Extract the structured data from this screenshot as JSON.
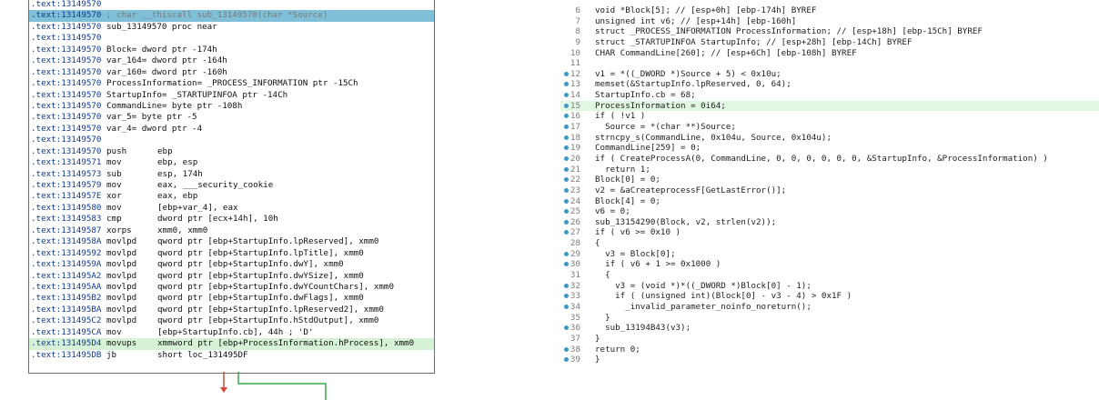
{
  "disasm": {
    "lines": [
      {
        "addr": ".text:13149570",
        "mn": "",
        "ops": "",
        "cmt": "",
        "hl": false
      },
      {
        "addr": ".text:13149570",
        "mn": "",
        "ops": "",
        "cmt": "; char __thiscall sub_13149570(char *Source)",
        "hl": true
      },
      {
        "addr": ".text:13149570",
        "mn": "sub_13149570 proc near",
        "ops": "",
        "cmt": "",
        "hl": false
      },
      {
        "addr": ".text:13149570",
        "mn": "",
        "ops": "",
        "cmt": "",
        "hl": false
      },
      {
        "addr": ".text:13149570",
        "mn": "Block= dword ptr -174h",
        "ops": "",
        "cmt": "",
        "hl": false
      },
      {
        "addr": ".text:13149570",
        "mn": "var_164= dword ptr -164h",
        "ops": "",
        "cmt": "",
        "hl": false
      },
      {
        "addr": ".text:13149570",
        "mn": "var_160= dword ptr -160h",
        "ops": "",
        "cmt": "",
        "hl": false
      },
      {
        "addr": ".text:13149570",
        "mn": "ProcessInformation= _PROCESS_INFORMATION ptr -15Ch",
        "ops": "",
        "cmt": "",
        "hl": false
      },
      {
        "addr": ".text:13149570",
        "mn": "StartupInfo= _STARTUPINFOA ptr -14Ch",
        "ops": "",
        "cmt": "",
        "hl": false
      },
      {
        "addr": ".text:13149570",
        "mn": "CommandLine= byte ptr -108h",
        "ops": "",
        "cmt": "",
        "hl": false
      },
      {
        "addr": ".text:13149570",
        "mn": "var_5= byte ptr -5",
        "ops": "",
        "cmt": "",
        "hl": false
      },
      {
        "addr": ".text:13149570",
        "mn": "var_4= dword ptr -4",
        "ops": "",
        "cmt": "",
        "hl": false
      },
      {
        "addr": ".text:13149570",
        "mn": "",
        "ops": "",
        "cmt": "",
        "hl": false
      },
      {
        "addr": ".text:13149570",
        "mn": "push",
        "ops": "ebp",
        "cmt": "",
        "hl": false
      },
      {
        "addr": ".text:13149571",
        "mn": "mov",
        "ops": "ebp, esp",
        "cmt": "",
        "hl": false
      },
      {
        "addr": ".text:13149573",
        "mn": "sub",
        "ops": "esp, 174h",
        "cmt": "",
        "hl": false
      },
      {
        "addr": ".text:13149579",
        "mn": "mov",
        "ops": "eax, ___security_cookie",
        "cmt": "",
        "hl": false
      },
      {
        "addr": ".text:1314957E",
        "mn": "xor",
        "ops": "eax, ebp",
        "cmt": "",
        "hl": false
      },
      {
        "addr": ".text:13149580",
        "mn": "mov",
        "ops": "[ebp+var_4], eax",
        "cmt": "",
        "hl": false
      },
      {
        "addr": ".text:13149583",
        "mn": "cmp",
        "ops": "dword ptr [ecx+14h], 10h",
        "cmt": "",
        "hl": false
      },
      {
        "addr": ".text:13149587",
        "mn": "xorps",
        "ops": "xmm0, xmm0",
        "cmt": "",
        "hl": false
      },
      {
        "addr": ".text:1314958A",
        "mn": "movlpd",
        "ops": "qword ptr [ebp+StartupInfo.lpReserved], xmm0",
        "cmt": "",
        "hl": false
      },
      {
        "addr": ".text:13149592",
        "mn": "movlpd",
        "ops": "qword ptr [ebp+StartupInfo.lpTitle], xmm0",
        "cmt": "",
        "hl": false
      },
      {
        "addr": ".text:1314959A",
        "mn": "movlpd",
        "ops": "qword ptr [ebp+StartupInfo.dwY], xmm0",
        "cmt": "",
        "hl": false
      },
      {
        "addr": ".text:131495A2",
        "mn": "movlpd",
        "ops": "qword ptr [ebp+StartupInfo.dwYSize], xmm0",
        "cmt": "",
        "hl": false
      },
      {
        "addr": ".text:131495AA",
        "mn": "movlpd",
        "ops": "qword ptr [ebp+StartupInfo.dwYCountChars], xmm0",
        "cmt": "",
        "hl": false
      },
      {
        "addr": ".text:131495B2",
        "mn": "movlpd",
        "ops": "qword ptr [ebp+StartupInfo.dwFlags], xmm0",
        "cmt": "",
        "hl": false
      },
      {
        "addr": ".text:131495BA",
        "mn": "movlpd",
        "ops": "qword ptr [ebp+StartupInfo.lpReserved2], xmm0",
        "cmt": "",
        "hl": false
      },
      {
        "addr": ".text:131495C2",
        "mn": "movlpd",
        "ops": "qword ptr [ebp+StartupInfo.hStdOutput], xmm0",
        "cmt": "",
        "hl": false
      },
      {
        "addr": ".text:131495CA",
        "mn": "mov",
        "ops": "[ebp+StartupInfo.cb], 44h ; 'D'",
        "cmt": "",
        "hl": false
      },
      {
        "addr": ".text:131495D4",
        "mn": "movups",
        "ops": "xmmword ptr [ebp+ProcessInformation.hProcess], xmm0",
        "cmt": "",
        "hl": false,
        "sel": true
      },
      {
        "addr": ".text:131495DB",
        "mn": "jb",
        "ops": "short loc_131495DF",
        "cmt": "",
        "hl": false
      }
    ]
  },
  "pseudocode": {
    "lines": [
      {
        "n": "6",
        "dot": false,
        "cur": false,
        "code": "void *Block[5]; // [esp+0h] [ebp-174h] BYREF"
      },
      {
        "n": "7",
        "dot": false,
        "cur": false,
        "code": "unsigned int v6; // [esp+14h] [ebp-160h]"
      },
      {
        "n": "8",
        "dot": false,
        "cur": false,
        "code": "struct _PROCESS_INFORMATION ProcessInformation; // [esp+18h] [ebp-15Ch] BYREF"
      },
      {
        "n": "9",
        "dot": false,
        "cur": false,
        "code": "struct _STARTUPINFOA StartupInfo; // [esp+28h] [ebp-14Ch] BYREF"
      },
      {
        "n": "10",
        "dot": false,
        "cur": false,
        "code": "CHAR CommandLine[260]; // [esp+6Ch] [ebp-108h] BYREF"
      },
      {
        "n": "11",
        "dot": false,
        "cur": false,
        "code": ""
      },
      {
        "n": "12",
        "dot": true,
        "cur": false,
        "code": "v1 = *((_DWORD *)Source + 5) < 0x10u;"
      },
      {
        "n": "13",
        "dot": true,
        "cur": false,
        "code": "memset(&StartupInfo.lpReserved, 0, 64);"
      },
      {
        "n": "14",
        "dot": true,
        "cur": false,
        "code": "StartupInfo.cb = 68;"
      },
      {
        "n": "15",
        "dot": true,
        "cur": true,
        "code": "ProcessInformation = 0i64;"
      },
      {
        "n": "16",
        "dot": true,
        "cur": false,
        "code": "if ( !v1 )"
      },
      {
        "n": "17",
        "dot": true,
        "cur": false,
        "code": "  Source = *(char **)Source;"
      },
      {
        "n": "18",
        "dot": true,
        "cur": false,
        "code": "strncpy_s(CommandLine, 0x104u, Source, 0x104u);"
      },
      {
        "n": "19",
        "dot": true,
        "cur": false,
        "code": "CommandLine[259] = 0;"
      },
      {
        "n": "20",
        "dot": true,
        "cur": false,
        "code": "if ( CreateProcessA(0, CommandLine, 0, 0, 0, 0, 0, 0, &StartupInfo, &ProcessInformation) )"
      },
      {
        "n": "21",
        "dot": true,
        "cur": false,
        "code": "  return 1;"
      },
      {
        "n": "22",
        "dot": true,
        "cur": false,
        "code": "Block[0] = 0;"
      },
      {
        "n": "23",
        "dot": true,
        "cur": false,
        "code": "v2 = &aCreateprocessF[GetLastError()];"
      },
      {
        "n": "24",
        "dot": true,
        "cur": false,
        "code": "Block[4] = 0;"
      },
      {
        "n": "25",
        "dot": true,
        "cur": false,
        "code": "v6 = 0;"
      },
      {
        "n": "26",
        "dot": true,
        "cur": false,
        "code": "sub_13154290(Block, v2, strlen(v2));"
      },
      {
        "n": "27",
        "dot": true,
        "cur": false,
        "code": "if ( v6 >= 0x10 )"
      },
      {
        "n": "28",
        "dot": false,
        "cur": false,
        "code": "{"
      },
      {
        "n": "29",
        "dot": true,
        "cur": false,
        "code": "  v3 = Block[0];"
      },
      {
        "n": "30",
        "dot": true,
        "cur": false,
        "code": "  if ( v6 + 1 >= 0x1000 )"
      },
      {
        "n": "31",
        "dot": false,
        "cur": false,
        "code": "  {"
      },
      {
        "n": "32",
        "dot": true,
        "cur": false,
        "code": "    v3 = (void *)*((_DWORD *)Block[0] - 1);"
      },
      {
        "n": "33",
        "dot": true,
        "cur": false,
        "code": "    if ( (unsigned int)(Block[0] - v3 - 4) > 0x1F )"
      },
      {
        "n": "34",
        "dot": true,
        "cur": false,
        "code": "      _invalid_parameter_noinfo_noreturn();"
      },
      {
        "n": "35",
        "dot": false,
        "cur": false,
        "code": "  }"
      },
      {
        "n": "36",
        "dot": true,
        "cur": false,
        "code": "  sub_13194B43(v3);"
      },
      {
        "n": "37",
        "dot": false,
        "cur": false,
        "code": "}"
      },
      {
        "n": "38",
        "dot": true,
        "cur": false,
        "code": "return 0;"
      },
      {
        "n": "39",
        "dot": true,
        "cur": false,
        "code": "}"
      }
    ]
  },
  "colors": {
    "accent_blue": "#3f97c8",
    "highlight_line": "#7fbfd8",
    "selected_line": "#e2f7e2",
    "edge_red": "#d24a3a",
    "edge_green": "#3aa64a"
  }
}
